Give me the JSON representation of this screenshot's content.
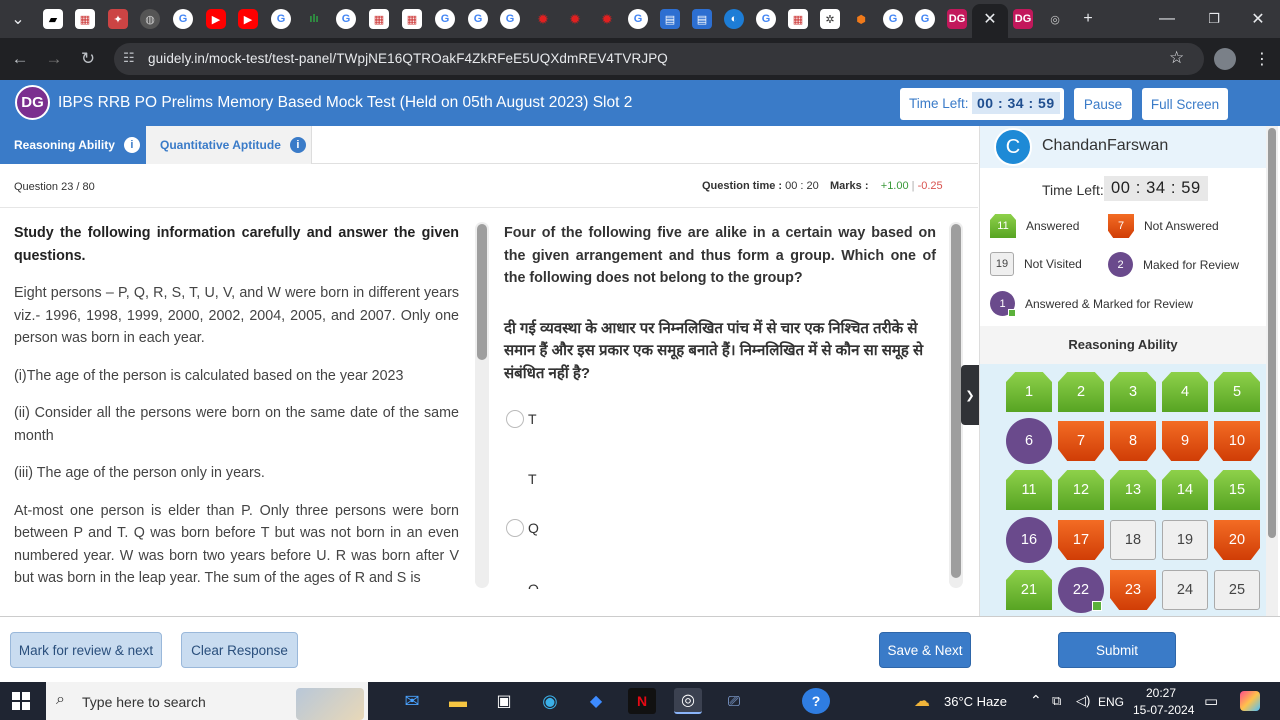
{
  "browser": {
    "url": "guidely.in/mock-test/test-panel/TWpjNE16QTROakF4ZkRFeE5UQXdmREV4TVRJPQ"
  },
  "header": {
    "logo_text": "DG",
    "title": "IBPS RRB PO Prelims Memory Based Mock Test (Held on 05th August 2023) Slot 2",
    "time_left_label": "Time Left:",
    "time_left_value": "00 : 34 : 59",
    "pause_label": "Pause",
    "fullscreen_label": "Full Screen"
  },
  "sections": [
    {
      "label": "Reasoning Ability",
      "active": true
    },
    {
      "label": "Quantitative Aptitude",
      "active": false
    }
  ],
  "question_info": {
    "number": "Question 23 / 80",
    "time_label": "Question time :",
    "time_value": "00 : 20",
    "marks_label": "Marks :",
    "plus": "+1.00",
    "sep": "|",
    "minus": "-0.25"
  },
  "passage": {
    "heading": "Study the following information carefully and answer the given questions.",
    "paragraphs": [
      "Eight persons – P, Q, R, S, T, U, V, and W were born in different years viz.- 1996, 1998, 1999, 2000, 2002, 2004, 2005, and 2007. Only one person was born in each year.",
      "(i)The age of the person is calculated based on the year 2023",
      "(ii) Consider all the persons were born on the same date of the same month",
      "(iii) The age of the person only in years.",
      "At-most one person is elder than P. Only three persons were born between P and T. Q was born before T but was not born in an even numbered year. W was born two years before U. R was born after V but was born in the leap year. The sum of the ages of R and S is"
    ]
  },
  "question": {
    "english": "Four of the following five are alike in a certain way based on the given arrangement and thus form a group. Which one of the following does not belong to the group?",
    "hindi": "दी गई व्यवस्था के आधार पर निम्नलिखित पांच में से चार एक निश्चित तरीके से समान हैं और इस प्रकार एक समूह बनाते हैं। निम्नलिखित में से कौन सा समूह से संबंधित नहीं है?",
    "options": [
      "T",
      "T",
      "Q",
      "Q"
    ]
  },
  "palette": {
    "user_initial": "C",
    "user_name": "ChandanFarswan",
    "time_left_label": "Time Left:",
    "time_left_value": "00 : 34 : 59",
    "legend": {
      "answered": {
        "count": "11",
        "label": "Answered"
      },
      "not_answered": {
        "count": "7",
        "label": "Not Answered"
      },
      "not_visited": {
        "count": "19",
        "label": "Not Visited"
      },
      "marked": {
        "count": "2",
        "label": "Maked for Review"
      },
      "answered_marked": {
        "count": "1",
        "label": "Answered & Marked for Review"
      }
    },
    "section_title": "Reasoning Ability",
    "questions": [
      {
        "n": "1",
        "s": "answered"
      },
      {
        "n": "2",
        "s": "answered"
      },
      {
        "n": "3",
        "s": "answered"
      },
      {
        "n": "4",
        "s": "answered"
      },
      {
        "n": "5",
        "s": "answered"
      },
      {
        "n": "6",
        "s": "review"
      },
      {
        "n": "7",
        "s": "notans"
      },
      {
        "n": "8",
        "s": "notans"
      },
      {
        "n": "9",
        "s": "notans"
      },
      {
        "n": "10",
        "s": "notans"
      },
      {
        "n": "11",
        "s": "answered"
      },
      {
        "n": "12",
        "s": "answered"
      },
      {
        "n": "13",
        "s": "answered"
      },
      {
        "n": "14",
        "s": "answered"
      },
      {
        "n": "15",
        "s": "answered"
      },
      {
        "n": "16",
        "s": "review"
      },
      {
        "n": "17",
        "s": "notans"
      },
      {
        "n": "18",
        "s": "notvis"
      },
      {
        "n": "19",
        "s": "notvis"
      },
      {
        "n": "20",
        "s": "notans"
      },
      {
        "n": "21",
        "s": "answered"
      },
      {
        "n": "22",
        "s": "answered_marked"
      },
      {
        "n": "23",
        "s": "notans"
      },
      {
        "n": "24",
        "s": "notvis"
      },
      {
        "n": "25",
        "s": "notvis"
      }
    ]
  },
  "footer": {
    "mark_review_label": "Mark for review & next",
    "clear_label": "Clear Response",
    "save_next_label": "Save & Next",
    "submit_label": "Submit"
  },
  "taskbar": {
    "search_placeholder": "Type here to search",
    "weather": "36°C  Haze",
    "lang": "ENG",
    "time": "20:27",
    "date": "15-07-2024"
  },
  "colors": {
    "brand_blue": "#3a7bc8",
    "answered_green": "#57a423",
    "not_answered_orange": "#d03d06",
    "review_purple": "#6a4a8c"
  }
}
